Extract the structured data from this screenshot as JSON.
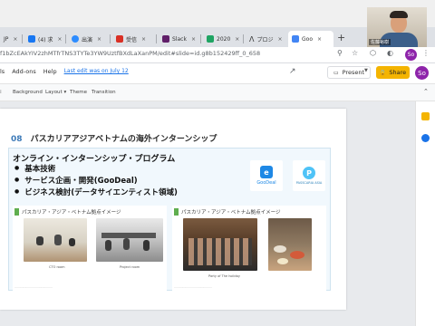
{
  "browser": {
    "tabs": [
      {
        "label": "JP",
        "icon": "tab-icon",
        "color": "#4285f4"
      },
      {
        "label": "(4) 求",
        "icon": "facebook-icon",
        "color": "#1877f2"
      },
      {
        "label": "出演",
        "icon": "zoom-icon",
        "color": "#2d8cff"
      },
      {
        "label": "受信",
        "icon": "gmail-icon",
        "color": "#d93025"
      },
      {
        "label": "Slack",
        "icon": "slack-icon",
        "color": "#611f69"
      },
      {
        "label": "2020",
        "icon": "drive-icon",
        "color": "#1fa463"
      },
      {
        "label": "プロジ",
        "icon": "arrow-logo-icon",
        "color": "#333333"
      },
      {
        "label": "Goo",
        "icon": "google-slides-icon",
        "color": "#4285f4"
      }
    ],
    "new_tab": "+",
    "url": "f1bZcEAkYIV2zhMTfrTNS3TYTe3YW9UztfBXdLaXanPM/edit#slide=id.g8b152429ff_0_658",
    "profile_initials": "So"
  },
  "docs": {
    "menu": [
      "ls",
      "Add-ons",
      "Help"
    ],
    "last_edit": "Last edit was on July 12",
    "present_label": "Present",
    "share_label": "Share",
    "avatar_initials": "So",
    "toolbar": [
      "Background",
      "Layout ▾",
      "Theme",
      "Transition"
    ]
  },
  "slide": {
    "number": "08",
    "title": "パスカリアアジアベトナムの海外インターンシップ",
    "program_title": "オンライン・インターンシップ・プログラム",
    "bullets": [
      "基本技術",
      "サービス企画・開発(GooDeal)",
      "ビジネス検討(データサイエンティスト領域)"
    ],
    "logo_goodeal": "GooDeal",
    "logo_passcaria": "PASSCARIA ASIA",
    "panel_left_title": "パスカリア・アジア・ベトナム拠点イメージ",
    "panel_right_title": "パスカリア・アジア・ベトナム拠点イメージ",
    "caption_cto": "CTO room",
    "caption_project": "Project room",
    "caption_party": "Party of The holiday"
  },
  "webcam": {
    "name": "佐藤裕樹"
  },
  "colors": {
    "share": "#f4b400",
    "avatar": "#8e24aa",
    "title_number": "#3d7ab8",
    "panel_marker": "#5fae4f"
  }
}
